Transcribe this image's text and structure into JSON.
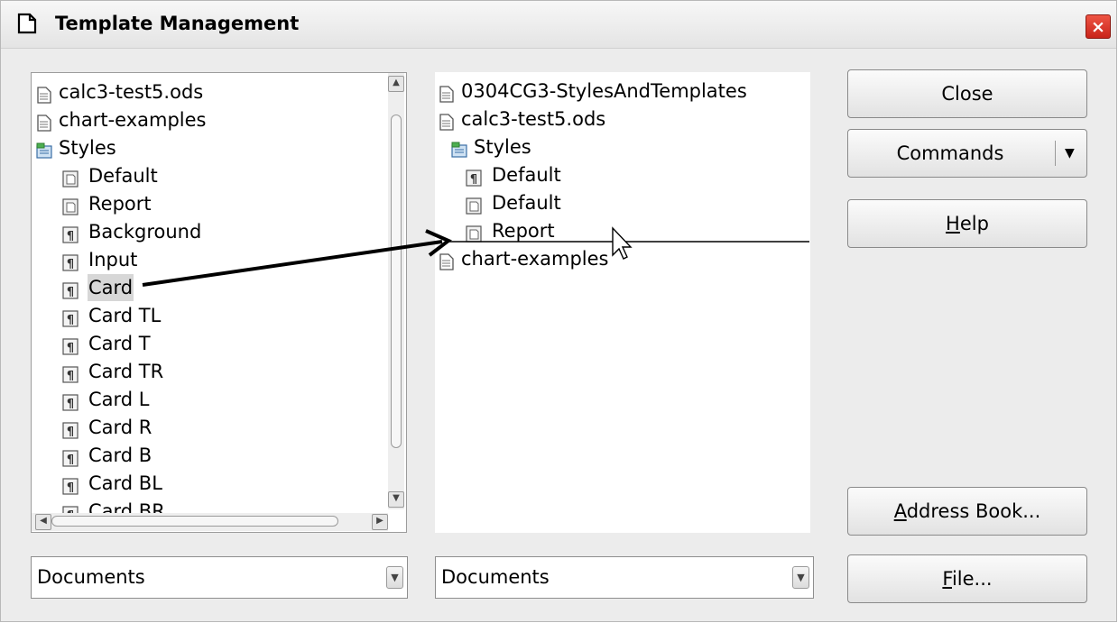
{
  "window": {
    "title": "Template Management",
    "close_glyph": "×"
  },
  "left_tree": {
    "items": [
      {
        "label": "calc3-test5.ods",
        "icon": "document-icon",
        "level": 0
      },
      {
        "label": "chart-examples",
        "icon": "document-icon",
        "level": 0
      },
      {
        "label": "Styles",
        "icon": "styles-folder-icon",
        "level": 1
      },
      {
        "label": "Default",
        "icon": "page-style-icon",
        "level": 2
      },
      {
        "label": "Report",
        "icon": "page-style-icon",
        "level": 2
      },
      {
        "label": "Background",
        "icon": "paragraph-style-icon",
        "level": 2
      },
      {
        "label": "Input",
        "icon": "paragraph-style-icon",
        "level": 2
      },
      {
        "label": "Card",
        "icon": "paragraph-style-icon",
        "level": 2,
        "selected": true
      },
      {
        "label": "Card TL",
        "icon": "paragraph-style-icon",
        "level": 2
      },
      {
        "label": "Card T",
        "icon": "paragraph-style-icon",
        "level": 2
      },
      {
        "label": "Card TR",
        "icon": "paragraph-style-icon",
        "level": 2
      },
      {
        "label": "Card L",
        "icon": "paragraph-style-icon",
        "level": 2
      },
      {
        "label": "Card R",
        "icon": "paragraph-style-icon",
        "level": 2
      },
      {
        "label": "Card B",
        "icon": "paragraph-style-icon",
        "level": 2
      },
      {
        "label": "Card BL",
        "icon": "paragraph-style-icon",
        "level": 2
      },
      {
        "label": "Card BR",
        "icon": "paragraph-style-icon",
        "level": 2
      }
    ]
  },
  "right_tree": {
    "items": [
      {
        "label": "0304CG3-StylesAndTemplates",
        "icon": "document-icon",
        "level": 0
      },
      {
        "label": "calc3-test5.ods",
        "icon": "document-icon",
        "level": 0
      },
      {
        "label": "Styles",
        "icon": "styles-folder-icon",
        "level": 1
      },
      {
        "label": "Default",
        "icon": "paragraph-style-icon",
        "level": 2
      },
      {
        "label": "Default",
        "icon": "page-style-icon",
        "level": 2
      },
      {
        "label": "Report",
        "icon": "page-style-icon",
        "level": 2
      },
      {
        "label": "chart-examples",
        "icon": "document-icon",
        "level": 0
      }
    ]
  },
  "buttons": {
    "close": "Close",
    "commands": "Commands",
    "help_mnemonic": "H",
    "help_rest": "elp",
    "address_mnemonic": "A",
    "address_rest": "ddress Book...",
    "file_mnemonic": "F",
    "file_rest": "ile..."
  },
  "selectors": {
    "left": "Documents",
    "right": "Documents"
  },
  "colors": {
    "close_button": "#d8322a",
    "selection": "#d7d7d7",
    "dialog_bg": "#ececec"
  }
}
